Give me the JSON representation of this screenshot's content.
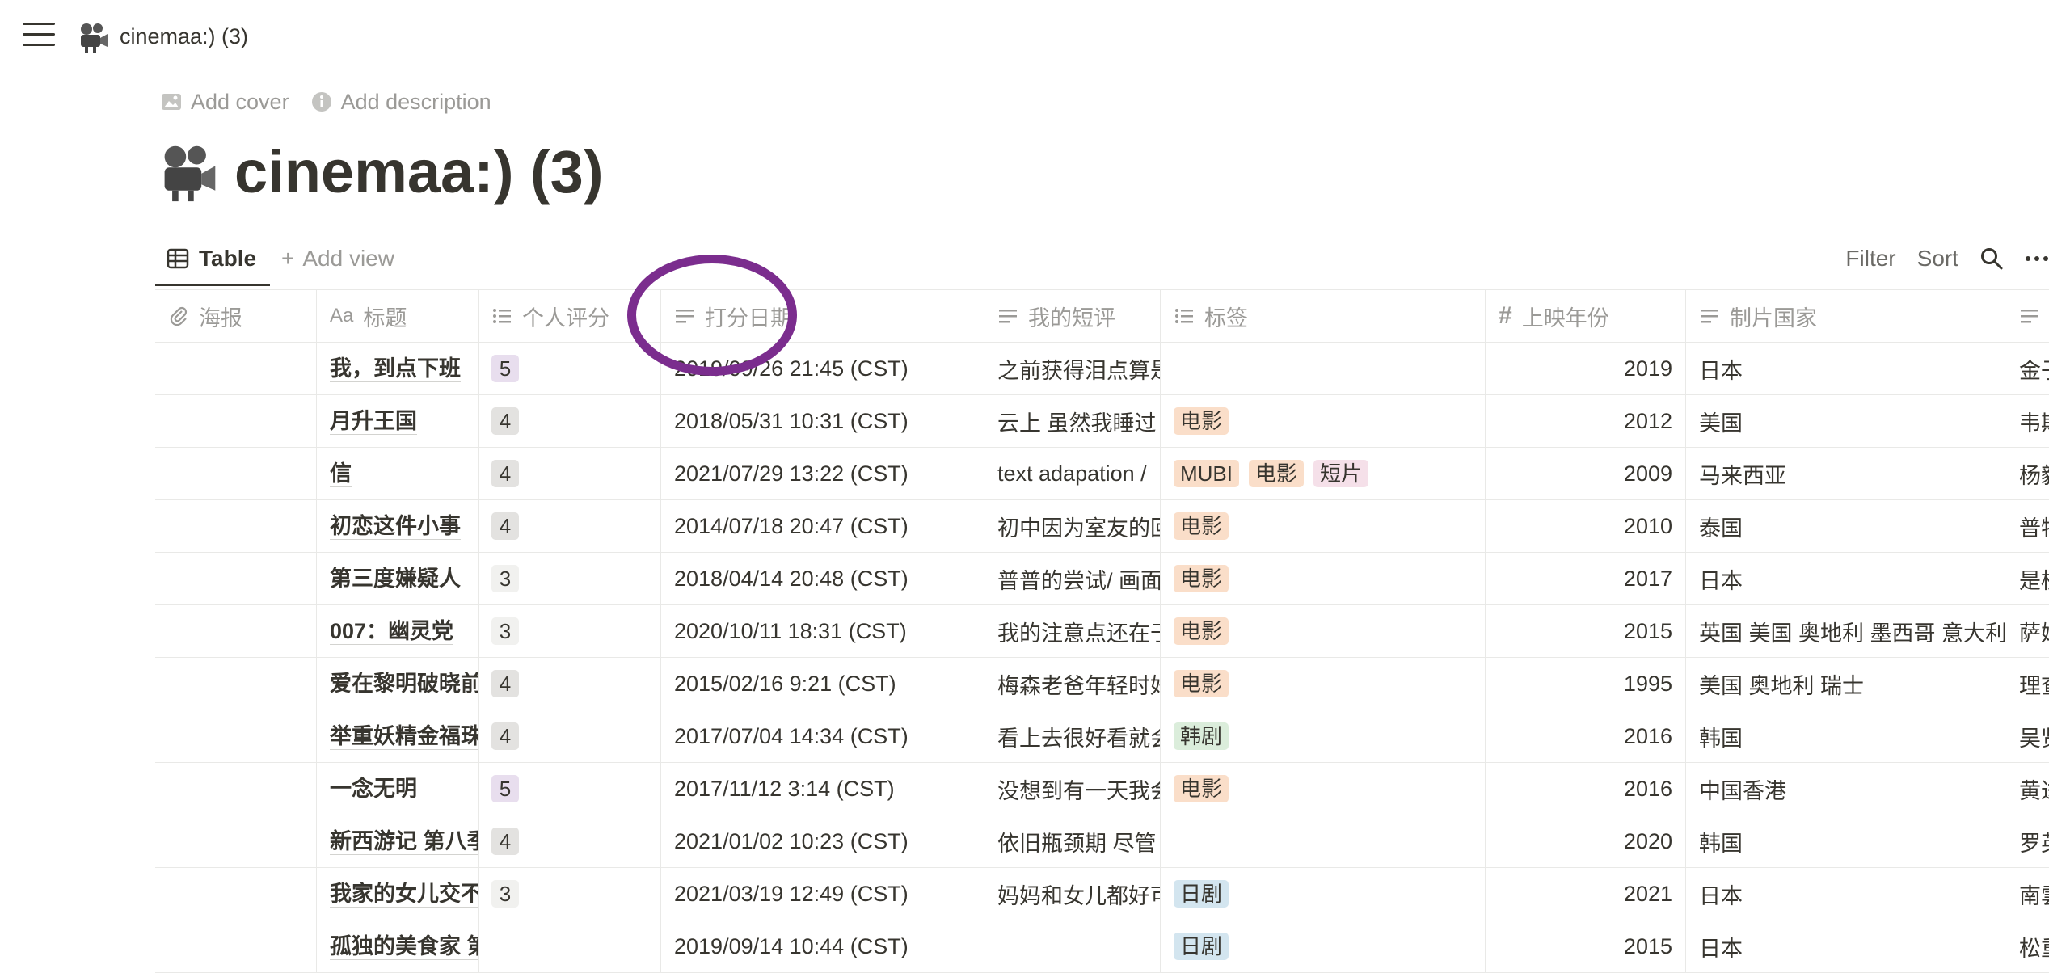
{
  "breadcrumb": {
    "title": "cinemaa:) (3)",
    "icon": "movie-camera-icon"
  },
  "page_controls": {
    "add_cover": "Add cover",
    "add_description": "Add description"
  },
  "page": {
    "title": "cinemaa:) (3)",
    "icon": "movie-camera-icon"
  },
  "views": {
    "active_tab": "Table",
    "add_view": "Add view"
  },
  "actions": {
    "filter": "Filter",
    "sort": "Sort",
    "search_icon": "search-icon",
    "more_icon": "more-icon"
  },
  "columns": {
    "poster": "海报",
    "title": "标题",
    "rating": "个人评分",
    "date": "打分日期",
    "review": "我的短评",
    "tags": "标签",
    "year": "上映年份",
    "country": "制片国家",
    "director": ""
  },
  "colors": {
    "annotation_circle": "#7b2d8e",
    "rating_5": "#e8deee",
    "rating_4": "#e3e2e0",
    "rating_3": "#f1f1ef",
    "tag_movie": "#fadec9",
    "tag_kdrama": "#dbeddb",
    "tag_jdrama": "#d3e5ef",
    "tag_short": "#f5e0e9"
  },
  "rows": [
    {
      "title": "我，到点下班",
      "rating": "5",
      "date": "2019/09/26 21:45 (CST)",
      "review": "之前获得泪点算是",
      "tags": [],
      "year": "2019",
      "country": "日本",
      "director": "金子"
    },
    {
      "title": "月升王国",
      "rating": "4",
      "date": "2018/05/31 10:31 (CST)",
      "review": "云上 虽然我睡过",
      "tags": [
        "电影"
      ],
      "year": "2012",
      "country": "美国",
      "director": "韦斯"
    },
    {
      "title": "信",
      "rating": "4",
      "date": "2021/07/29 13:22 (CST)",
      "review": "text adapation /",
      "tags": [
        "MUBI",
        "电影",
        "短片"
      ],
      "year": "2009",
      "country": "马来西亚",
      "director": "杨毅"
    },
    {
      "title": "初恋这件小事",
      "rating": "4",
      "date": "2014/07/18 20:47 (CST)",
      "review": "初中因为室友的回",
      "tags": [
        "电影"
      ],
      "year": "2010",
      "country": "泰国",
      "director": "普特"
    },
    {
      "title": "第三度嫌疑人",
      "rating": "3",
      "date": "2018/04/14 20:48 (CST)",
      "review": "普普的尝试/ 画面",
      "tags": [
        "电影"
      ],
      "year": "2017",
      "country": "日本",
      "director": "是枝"
    },
    {
      "title": "007：幽灵党",
      "rating": "3",
      "date": "2020/10/11 18:31 (CST)",
      "review": "我的注意点还在于",
      "tags": [
        "电影"
      ],
      "year": "2015",
      "country": "英国 美国 奥地利 墨西哥 意大利",
      "director": "萨姆"
    },
    {
      "title": "爱在黎明破晓前",
      "rating": "4",
      "date": "2015/02/16 9:21 (CST)",
      "review": "梅森老爸年轻时好",
      "tags": [
        "电影"
      ],
      "year": "1995",
      "country": "美国 奥地利 瑞士",
      "director": "理查"
    },
    {
      "title": "举重妖精金福珠",
      "rating": "4",
      "date": "2017/07/04 14:34 (CST)",
      "review": "看上去很好看就会",
      "tags": [
        "韩剧"
      ],
      "year": "2016",
      "country": "韩国",
      "director": "吴贤"
    },
    {
      "title": "一念无明",
      "rating": "5",
      "date": "2017/11/12 3:14 (CST)",
      "review": "没想到有一天我会",
      "tags": [
        "电影"
      ],
      "year": "2016",
      "country": "中国香港",
      "director": "黄进"
    },
    {
      "title": "新西游记 第八季",
      "rating": "4",
      "date": "2021/01/02 10:23 (CST)",
      "review": "依旧瓶颈期 尽管",
      "tags": [],
      "year": "2020",
      "country": "韩国",
      "director": "罗英"
    },
    {
      "title": "我家的女儿交不到男朋友",
      "rating": "3",
      "date": "2021/03/19 12:49 (CST)",
      "review": "妈妈和女儿都好可",
      "tags": [
        "日剧"
      ],
      "year": "2021",
      "country": "日本",
      "director": "南雲"
    },
    {
      "title": "孤独的美食家 第五季",
      "rating": "",
      "date": "2019/09/14 10:44 (CST)",
      "review": "",
      "tags": [
        "日剧"
      ],
      "year": "2015",
      "country": "日本",
      "director": "松重"
    }
  ]
}
